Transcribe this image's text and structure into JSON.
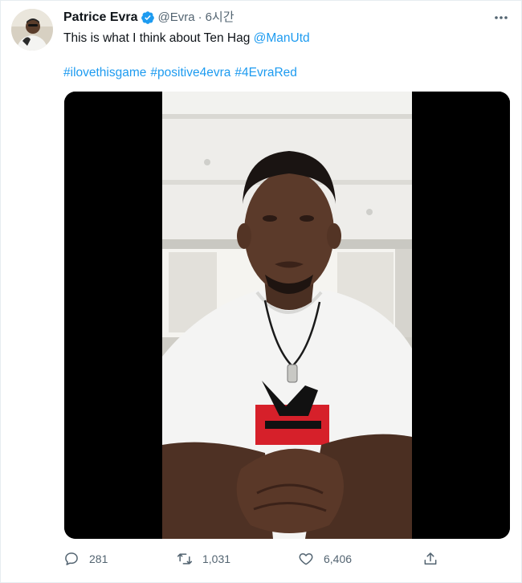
{
  "tweet": {
    "author": {
      "display_name": "Patrice Evra",
      "handle": "@Evra",
      "verified": true
    },
    "separator": "·",
    "time": "6시간",
    "text": {
      "main": "This is what I think about Ten Hag ",
      "mention": "@ManUtd"
    },
    "hashtags": [
      "#ilovethisgame",
      "#positive4evra",
      "#4EvraRed"
    ],
    "media": {
      "type": "video",
      "icon": "video-thumbnail"
    },
    "actions": {
      "reply_count": "281",
      "retweet_count": "1,031",
      "like_count": "6,406"
    }
  },
  "colors": {
    "link": "#1d9bf0",
    "text": "#0f1419",
    "secondary": "#536471",
    "verified": "#1d9bf0"
  },
  "icons": {
    "more": "more-dots-icon",
    "reply": "reply-icon",
    "retweet": "retweet-icon",
    "like": "heart-icon",
    "share": "share-icon",
    "verified": "verified-badge-icon"
  }
}
